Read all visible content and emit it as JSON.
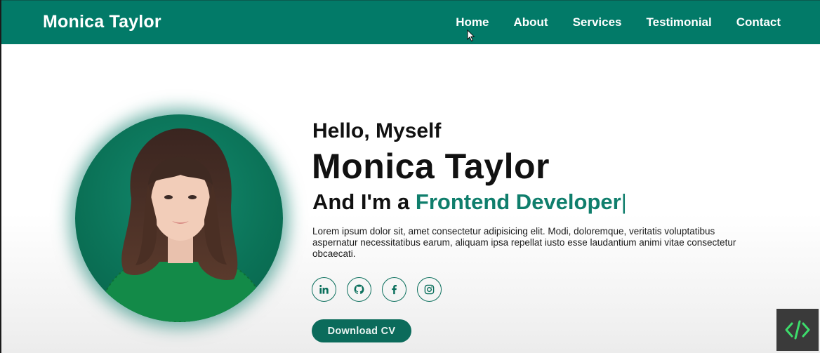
{
  "navbar": {
    "brand": "Monica Taylor",
    "links": [
      "Home",
      "About",
      "Services",
      "Testimonial",
      "Contact"
    ]
  },
  "hero": {
    "greeting": "Hello, Myself",
    "name": "Monica Taylor",
    "role_prefix": "And I'm a ",
    "role": "Frontend Developer",
    "caret": "|",
    "description": "Lorem ipsum dolor sit, amet consectetur adipisicing elit. Modi, doloremque, veritatis voluptatibus aspernatur necessitatibus earum, aliquam ipsa repellat iusto esse laudantium animi vitae consectetur obcaecati.",
    "socials": [
      "linkedin-icon",
      "github-icon",
      "facebook-icon",
      "instagram-icon"
    ],
    "cv_button": "Download CV"
  },
  "colors": {
    "primary": "#027a68",
    "accent_text": "#0f7e6c",
    "button": "#0b6b5b"
  },
  "overlay": {
    "badge_icon": "code-icon"
  }
}
